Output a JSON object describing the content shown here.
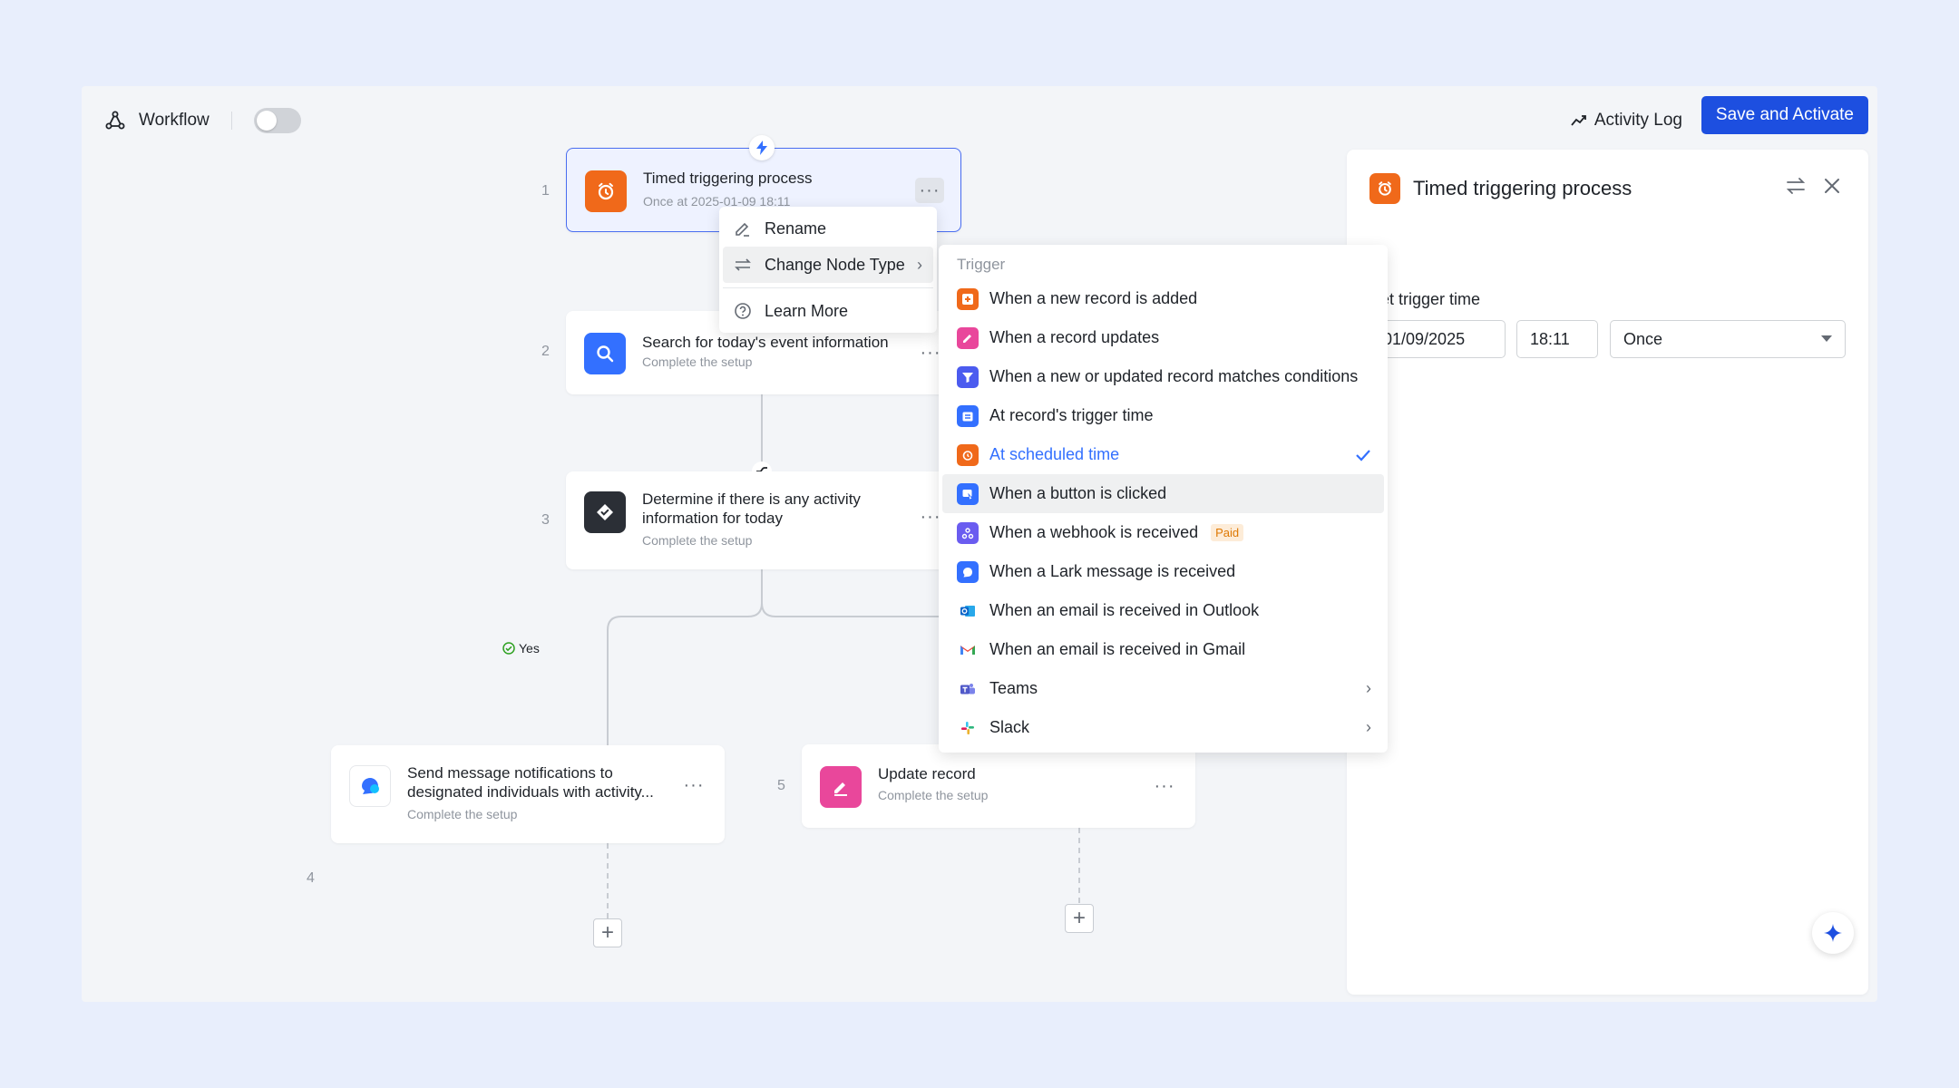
{
  "header": {
    "title": "Workflow",
    "activity_log": "Activity Log",
    "save_label": "Save and Activate"
  },
  "nodes": [
    {
      "num": "1",
      "title": "Timed triggering process",
      "subtitle": "Once at 2025-01-09 18:11"
    },
    {
      "num": "2",
      "title": "Search for today's event information",
      "subtitle": "Complete the setup"
    },
    {
      "num": "3",
      "title_line1": "Determine if there is any activity",
      "title_line2": "information for today",
      "subtitle": "Complete the setup"
    },
    {
      "num": "4",
      "title_line1": "Send message notifications to",
      "title_line2": "designated individuals with activity...",
      "subtitle": "Complete the setup"
    },
    {
      "num": "5",
      "title": "Update record",
      "subtitle": "Complete the setup"
    }
  ],
  "branch": {
    "yes_label": "Yes"
  },
  "context_menu": {
    "rename": "Rename",
    "change_node_type": "Change Node Type",
    "learn_more": "Learn More"
  },
  "trigger_menu": {
    "heading": "Trigger",
    "items": [
      {
        "label": "When a new record is added",
        "icon": "record-add-icon",
        "color": "#f0691a"
      },
      {
        "label": "When a record updates",
        "icon": "pencil-icon",
        "color": "#e9479b"
      },
      {
        "label": "When a new or updated record matches conditions",
        "icon": "filter-icon",
        "color": "#4b5bef"
      },
      {
        "label": "At record's trigger time",
        "icon": "calendar-icon",
        "color": "#3370ff"
      },
      {
        "label": "At scheduled time",
        "icon": "alarm-icon",
        "color": "#f0691a"
      },
      {
        "label": "When a button is clicked",
        "icon": "button-click-icon",
        "color": "#3370ff"
      },
      {
        "label": "When a webhook is received",
        "icon": "webhook-icon",
        "color": "#6a5cf0",
        "badge": "Paid"
      },
      {
        "label": "When a Lark message is received",
        "icon": "lark-message-icon",
        "color": "#3370ff"
      },
      {
        "label": "When an email is received in Outlook",
        "icon": "outlook-icon",
        "color": "#0a64c8"
      },
      {
        "label": "When an email is received in Gmail",
        "icon": "gmail-icon",
        "color": "#ea4335"
      },
      {
        "label": "Teams",
        "icon": "teams-icon",
        "color": "#5059c9"
      },
      {
        "label": "Slack",
        "icon": "slack-icon",
        "color": "#e01e5a"
      }
    ]
  },
  "panel": {
    "title": "Timed triggering process",
    "label": "Set trigger time",
    "date": "01/09/2025",
    "time": "18:11",
    "repeat": "Once"
  },
  "colors": {
    "primary": "#1d4fe0",
    "accent": "#3370ff",
    "orange": "#f0691a"
  }
}
